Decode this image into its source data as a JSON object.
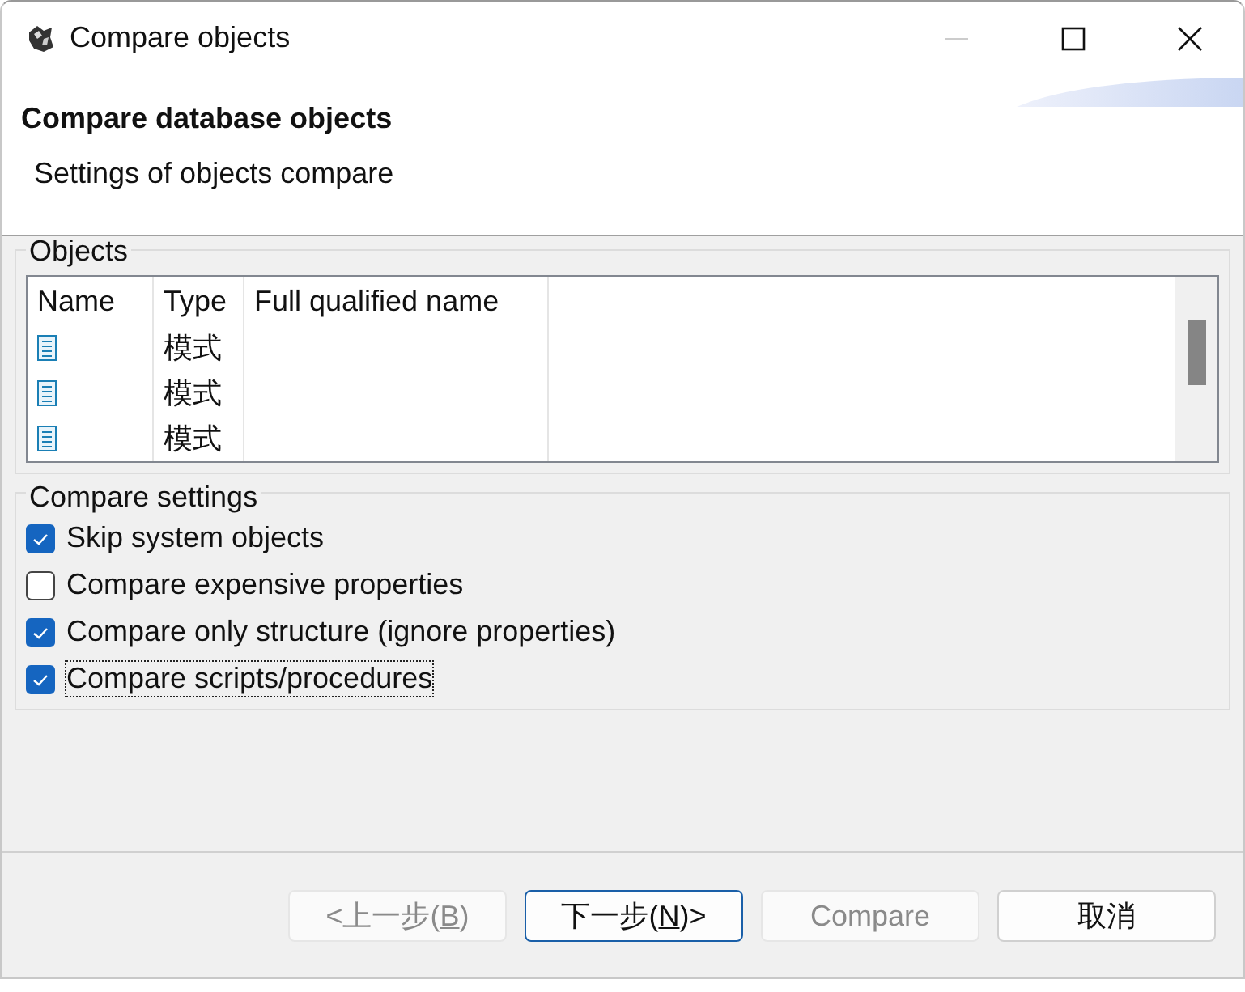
{
  "window": {
    "title": "Compare objects"
  },
  "header": {
    "title": "Compare database objects",
    "subtitle": "Settings of objects compare"
  },
  "objects": {
    "label": "Objects",
    "columns": [
      "Name",
      "Type",
      "Full qualified name"
    ],
    "rows": [
      {
        "type": "模式"
      },
      {
        "type": "模式"
      },
      {
        "type": "模式"
      }
    ]
  },
  "compare_settings": {
    "label": "Compare settings",
    "options": [
      {
        "label": "Skip system objects",
        "checked": true,
        "focused": false
      },
      {
        "label": "Compare expensive properties",
        "checked": false,
        "focused": false
      },
      {
        "label": "Compare only structure (ignore properties)",
        "checked": true,
        "focused": false
      },
      {
        "label": "Compare scripts/procedures",
        "checked": true,
        "focused": true
      }
    ]
  },
  "buttons": [
    {
      "prefix": "<上一步(",
      "key": "B",
      "suffix": ")",
      "disabled": true,
      "default": false
    },
    {
      "prefix": "下一步(",
      "key": "N",
      "suffix": ")>",
      "disabled": false,
      "default": true
    },
    {
      "prefix": "Compare",
      "disabled": true,
      "default": false
    },
    {
      "prefix": "取消",
      "disabled": false,
      "default": false
    }
  ]
}
